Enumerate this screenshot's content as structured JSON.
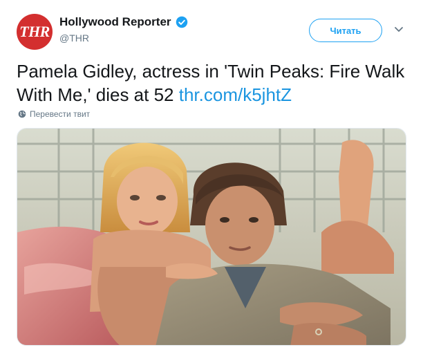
{
  "author": {
    "name": "Hollywood Reporter",
    "handle": "@THR",
    "avatar_text": "THR",
    "verified": true,
    "avatar_color": "#d32f2f"
  },
  "follow_button": {
    "label": "Читать"
  },
  "tweet": {
    "text": "Pamela Gidley, actress in 'Twin Peaks: Fire Walk With Me,' dies at 52 ",
    "link": "thr.com/k5jhtZ"
  },
  "translate": {
    "label": "Перевести твит"
  },
  "colors": {
    "accent": "#1da1f2",
    "link": "#1b95e0",
    "muted": "#657786"
  },
  "icons": {
    "verified": "verified-badge-icon",
    "caret": "chevron-down-icon",
    "globe": "globe-icon"
  }
}
